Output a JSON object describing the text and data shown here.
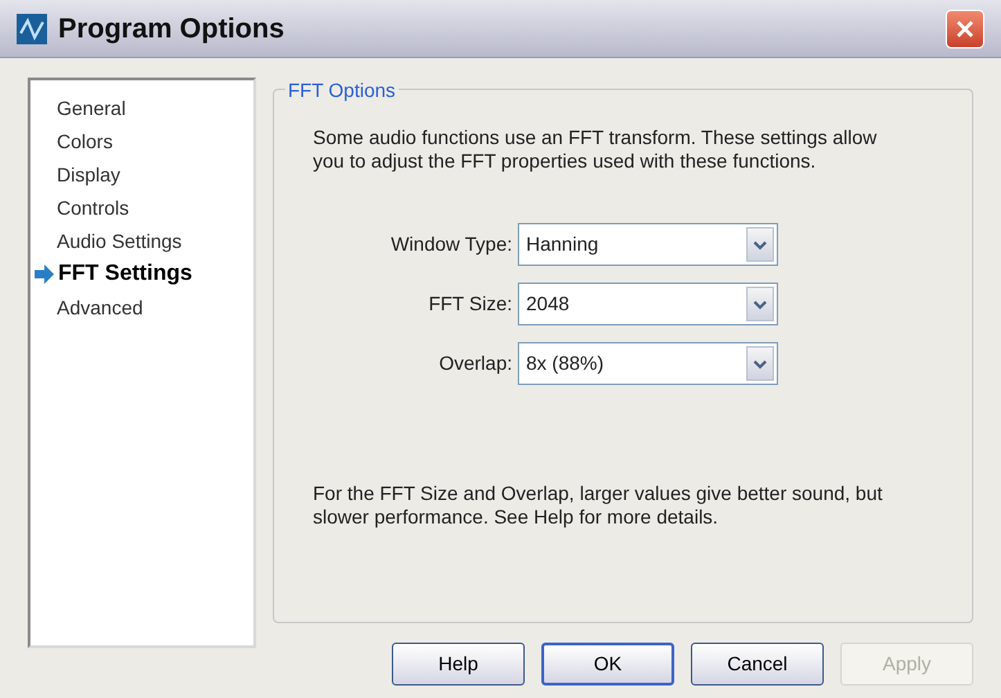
{
  "window": {
    "title": "Program Options"
  },
  "sidebar": {
    "items": [
      {
        "label": "General",
        "selected": false
      },
      {
        "label": "Colors",
        "selected": false
      },
      {
        "label": "Display",
        "selected": false
      },
      {
        "label": "Controls",
        "selected": false
      },
      {
        "label": "Audio Settings",
        "selected": false
      },
      {
        "label": "FFT Settings",
        "selected": true
      },
      {
        "label": "Advanced",
        "selected": false
      }
    ]
  },
  "group": {
    "title": "FFT Options",
    "intro": "Some audio functions use an FFT transform. These settings allow you to adjust the FFT properties used with these functions.",
    "fields": [
      {
        "label": "Window Type:",
        "value": "Hanning"
      },
      {
        "label": "FFT Size:",
        "value": "2048"
      },
      {
        "label": "Overlap:",
        "value": "8x (88%)"
      }
    ],
    "note": "For the FFT Size and Overlap, larger values give better sound, but slower performance. See Help for more details."
  },
  "buttons": [
    {
      "label": "Help",
      "disabled": false,
      "default": false
    },
    {
      "label": "OK",
      "disabled": false,
      "default": true
    },
    {
      "label": "Cancel",
      "disabled": false,
      "default": false
    },
    {
      "label": "Apply",
      "disabled": true,
      "default": false
    }
  ]
}
